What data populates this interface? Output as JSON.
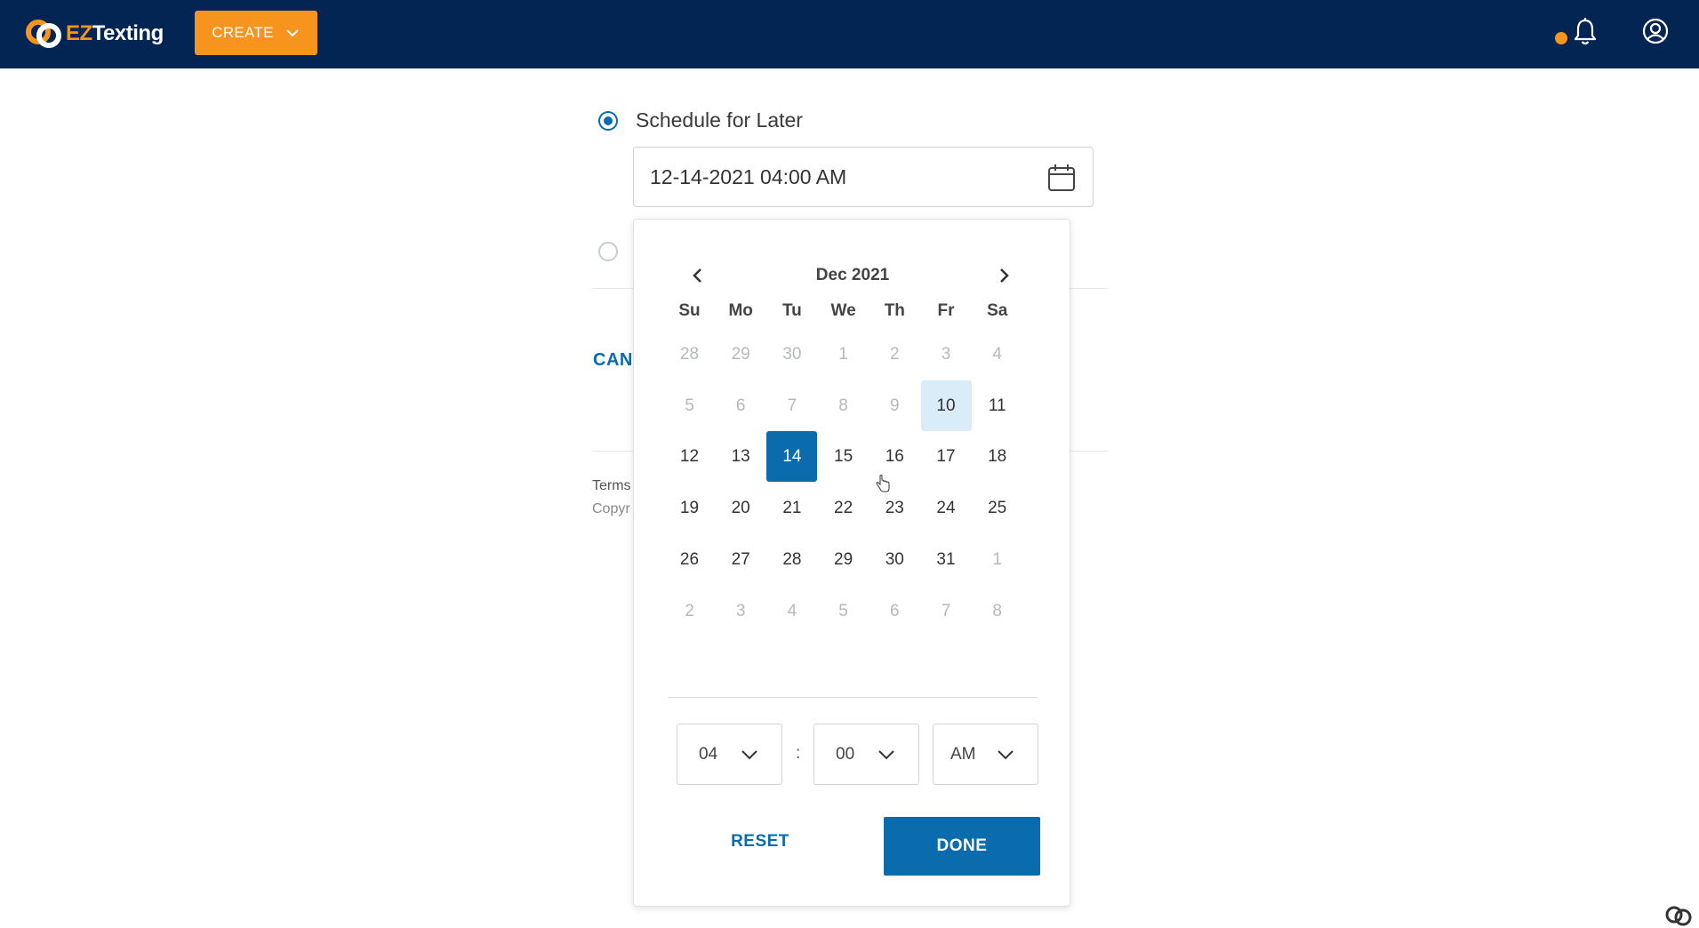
{
  "header": {
    "logo_prefix": "EZ",
    "logo_suffix": "Texting",
    "create_label": "CREATE",
    "brand_color": "#022554",
    "accent_color": "#f7941d"
  },
  "schedule": {
    "option_label": "Schedule for Later",
    "date_value": "12-14-2021 04:00 AM"
  },
  "background": {
    "cancel_label": "CANC",
    "terms_label": "Terms",
    "copyright_label": "Copyr"
  },
  "picker": {
    "month_title": "Dec 2021",
    "weekdays": [
      "Su",
      "Mo",
      "Tu",
      "We",
      "Th",
      "Fr",
      "Sa"
    ],
    "weeks": [
      [
        {
          "d": "28",
          "m": true
        },
        {
          "d": "29",
          "m": true
        },
        {
          "d": "30",
          "m": true
        },
        {
          "d": "1",
          "m": true
        },
        {
          "d": "2",
          "m": true
        },
        {
          "d": "3",
          "m": true
        },
        {
          "d": "4",
          "m": true
        }
      ],
      [
        {
          "d": "5",
          "m": true
        },
        {
          "d": "6",
          "m": true
        },
        {
          "d": "7",
          "m": true
        },
        {
          "d": "8",
          "m": true
        },
        {
          "d": "9",
          "m": true
        },
        {
          "d": "10",
          "today": true
        },
        {
          "d": "11"
        }
      ],
      [
        {
          "d": "12"
        },
        {
          "d": "13"
        },
        {
          "d": "14",
          "selected": true
        },
        {
          "d": "15"
        },
        {
          "d": "16"
        },
        {
          "d": "17"
        },
        {
          "d": "18"
        }
      ],
      [
        {
          "d": "19"
        },
        {
          "d": "20"
        },
        {
          "d": "21"
        },
        {
          "d": "22"
        },
        {
          "d": "23"
        },
        {
          "d": "24"
        },
        {
          "d": "25"
        }
      ],
      [
        {
          "d": "26"
        },
        {
          "d": "27"
        },
        {
          "d": "28"
        },
        {
          "d": "29"
        },
        {
          "d": "30"
        },
        {
          "d": "31"
        },
        {
          "d": "1",
          "m": true
        }
      ],
      [
        {
          "d": "2",
          "m": true
        },
        {
          "d": "3",
          "m": true
        },
        {
          "d": "4",
          "m": true
        },
        {
          "d": "5",
          "m": true
        },
        {
          "d": "6",
          "m": true
        },
        {
          "d": "7",
          "m": true
        },
        {
          "d": "8",
          "m": true
        }
      ]
    ],
    "hour_value": "04",
    "minute_value": "00",
    "ampm_value": "AM",
    "colon": ":",
    "reset_label": "RESET",
    "done_label": "DONE",
    "selected_color": "#0a6bad",
    "today_color": "#d9ecf8"
  }
}
